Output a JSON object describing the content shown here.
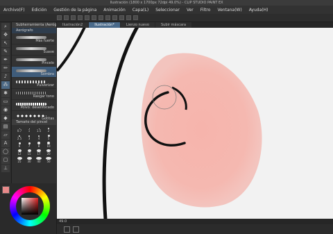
{
  "window": {
    "title": "Ilustración (1800 x 1700px 72dpi 49.0%) - CLIP STUDIO PAINT EX"
  },
  "menu": [
    "Archivo(F)",
    "Edición",
    "Gestión de la página",
    "Animación",
    "Capa(L)",
    "Seleccionar",
    "Ver",
    "Filtro",
    "Ventana(W)",
    "Ayuda(H)"
  ],
  "tabs": [
    "Ilustración2",
    "Ilustración*",
    "Lienzo nuevo",
    "Subir máscara"
  ],
  "subtool": {
    "header": "Subherramienta (Aerógrafo)",
    "group": "Aerógrafo",
    "items": [
      "Más fuerte",
      "Suave",
      "Pincelo",
      "Sombra",
      "Pulverizar",
      "Rasgar tono",
      "Polvo: desenfocado",
      "Gotitas"
    ],
    "selected": "Sombra"
  },
  "brush_size": {
    "header": "Tamaño del pincel",
    "sizes": [
      "0.7",
      "1",
      "1.5",
      "2",
      "2.5",
      "3",
      "4",
      "5",
      "6",
      "7",
      "8",
      "10",
      "12",
      "15",
      "17",
      "20",
      "25",
      "30",
      "40",
      "50"
    ]
  },
  "status": {
    "zoom": "49.0"
  },
  "colors": {
    "main": "#e88a8a",
    "sub": "#ffffff",
    "blush": "#f6b9b2",
    "accent": "#4a6a8a"
  },
  "tools": [
    "zoom",
    "move",
    "operation",
    "eyedropper",
    "pen",
    "pencil",
    "brush",
    "airbrush",
    "decoration",
    "eraser",
    "blend",
    "fill",
    "gradient",
    "figure",
    "text",
    "balloon",
    "frame",
    "ruler"
  ]
}
